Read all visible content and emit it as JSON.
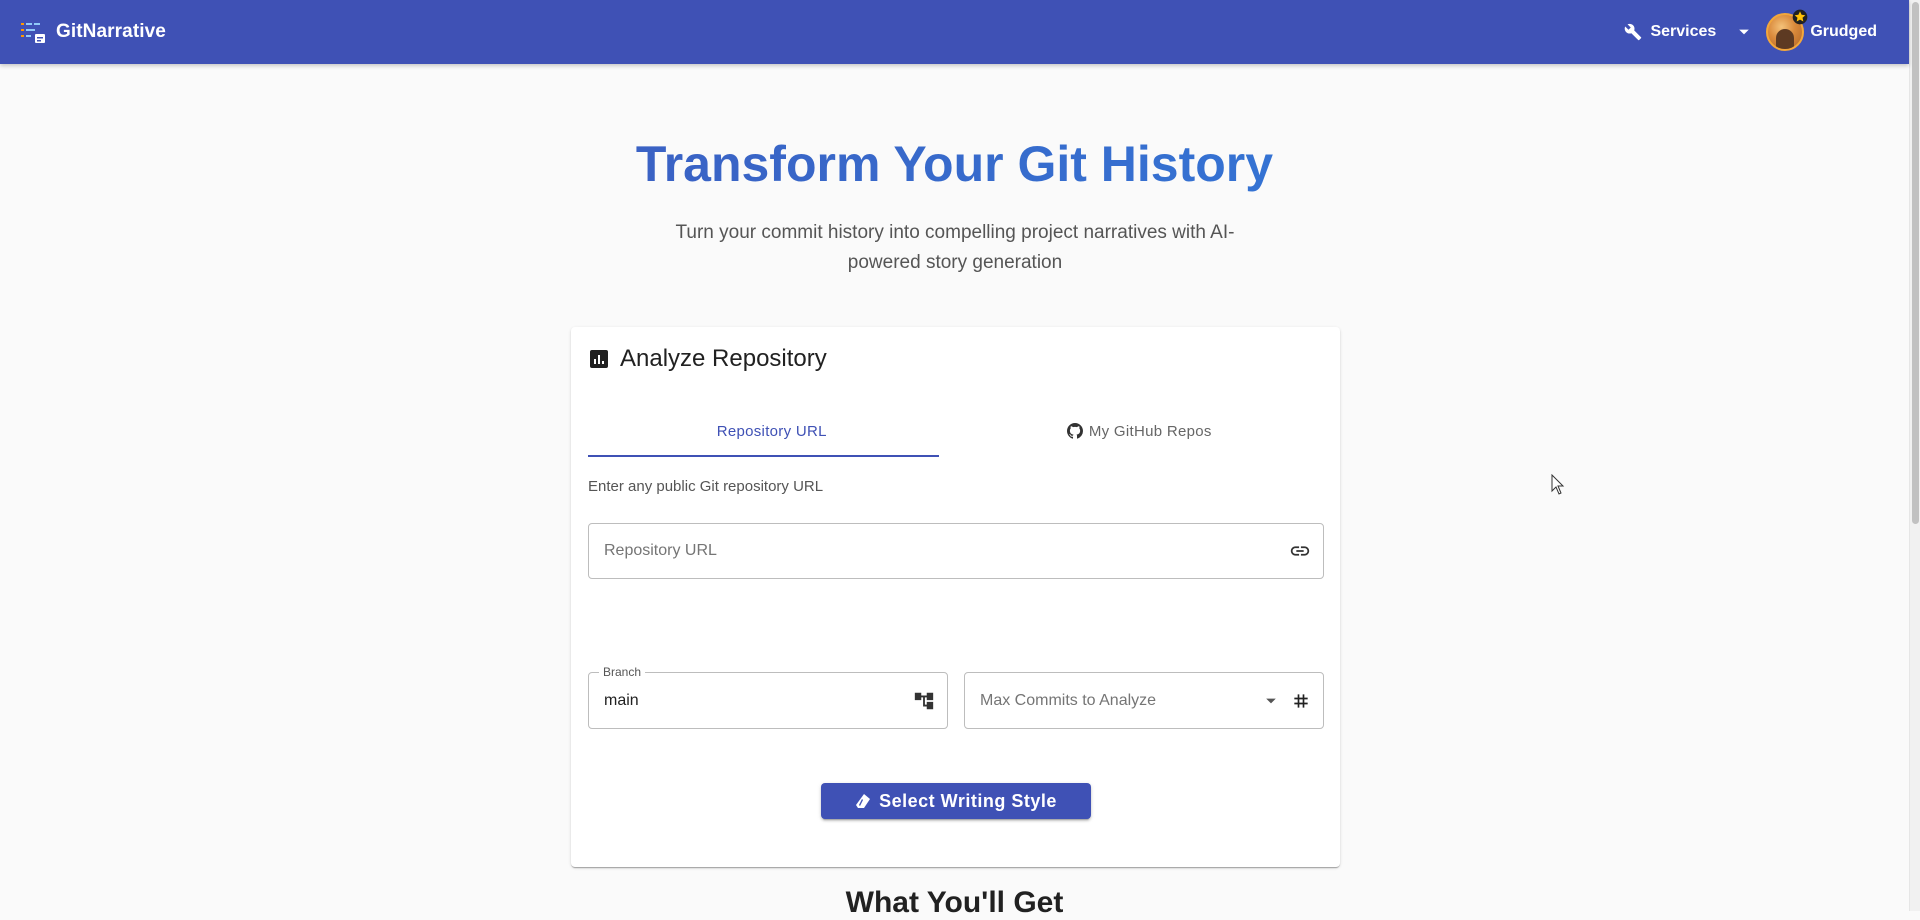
{
  "appbar": {
    "brand": "GitNarrative",
    "services_label": "Services",
    "user_name": "Grudged",
    "color": "#3f51b5"
  },
  "hero": {
    "title": "Transform Your Git History",
    "subtitle": "Turn your commit history into compelling project narratives with AI-powered story generation"
  },
  "card": {
    "title": "Analyze Repository",
    "tabs": [
      {
        "label": "Repository URL",
        "active": true
      },
      {
        "label": "My GitHub Repos",
        "active": false,
        "icon": "github-icon"
      }
    ],
    "help_text": "Enter any public Git repository URL",
    "repo_url": {
      "value": "",
      "placeholder": "Repository URL",
      "icon": "link-icon"
    },
    "branch": {
      "label": "Branch",
      "value": "main",
      "icon": "branch-icon"
    },
    "max_commits": {
      "placeholder": "Max Commits to Analyze",
      "icon": "hash-icon"
    },
    "style_button": "Select Writing Style"
  },
  "next_section_title": "What You'll Get"
}
